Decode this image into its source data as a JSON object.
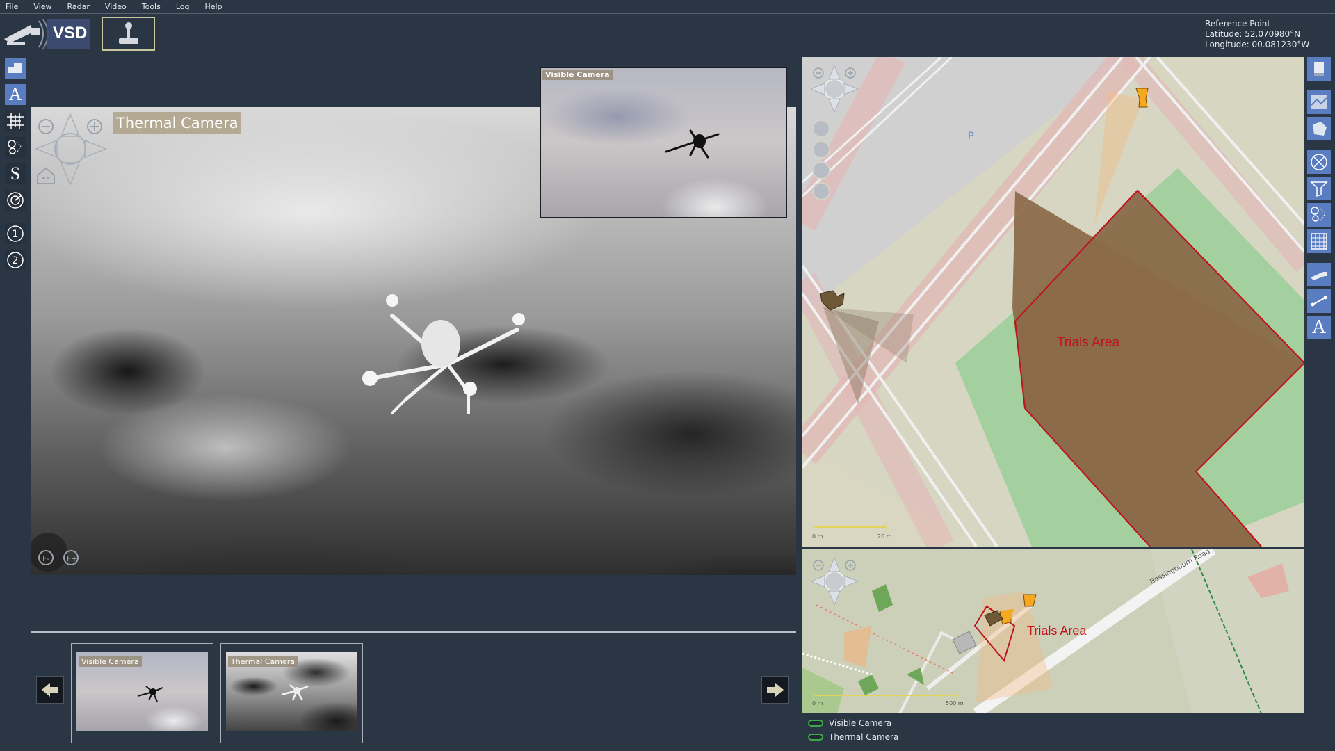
{
  "menu": [
    "File",
    "View",
    "Radar",
    "Video",
    "Tools",
    "Log",
    "Help"
  ],
  "app": {
    "logo_text": "VSD"
  },
  "reference": {
    "title": "Reference Point",
    "latitude": "Latitude: 52.070980°N",
    "longitude": "Longitude: 00.081230°W"
  },
  "left_toolbar": [
    "layers-icon",
    "text-icon",
    "grid-icon",
    "track-filter-icon",
    "s-tool-icon",
    "radar-icon",
    "preset-1-icon",
    "preset-2-icon"
  ],
  "right_toolbar": [
    "panel-icon",
    "map-image-icon",
    "polygon-icon",
    "sensor-sweep-icon",
    "filter-icon",
    "tracks-icon",
    "table-icon",
    "camera-tool-icon",
    "line-tool-icon",
    "text-tool-icon"
  ],
  "main_view": {
    "thermal_label": "Thermal Camera",
    "visible_label": "Visible Camera"
  },
  "thumbnails": [
    {
      "label": "Visible Camera"
    },
    {
      "label": "Thermal Camera"
    }
  ],
  "map_main": {
    "area_label": "Trials Area",
    "parking_label": "P",
    "scale_start": "0 m",
    "scale_end": "20 m"
  },
  "map_mini": {
    "area_label": "Trials Area",
    "road_label": "Bassingbourn Road",
    "scale_start": "0 m",
    "scale_end": "500 m"
  },
  "legend": [
    {
      "label": "Visible Camera",
      "color": "#3fa946"
    },
    {
      "label": "Thermal Camera",
      "color": "#3fa946"
    }
  ],
  "colors": {
    "background": "#2b3644",
    "toolbar_active": "#5a7cc0",
    "trials_area_fill": "#8b6a4a",
    "trials_area_stroke": "#c0131b",
    "camera_marker": "#f6a91f"
  }
}
